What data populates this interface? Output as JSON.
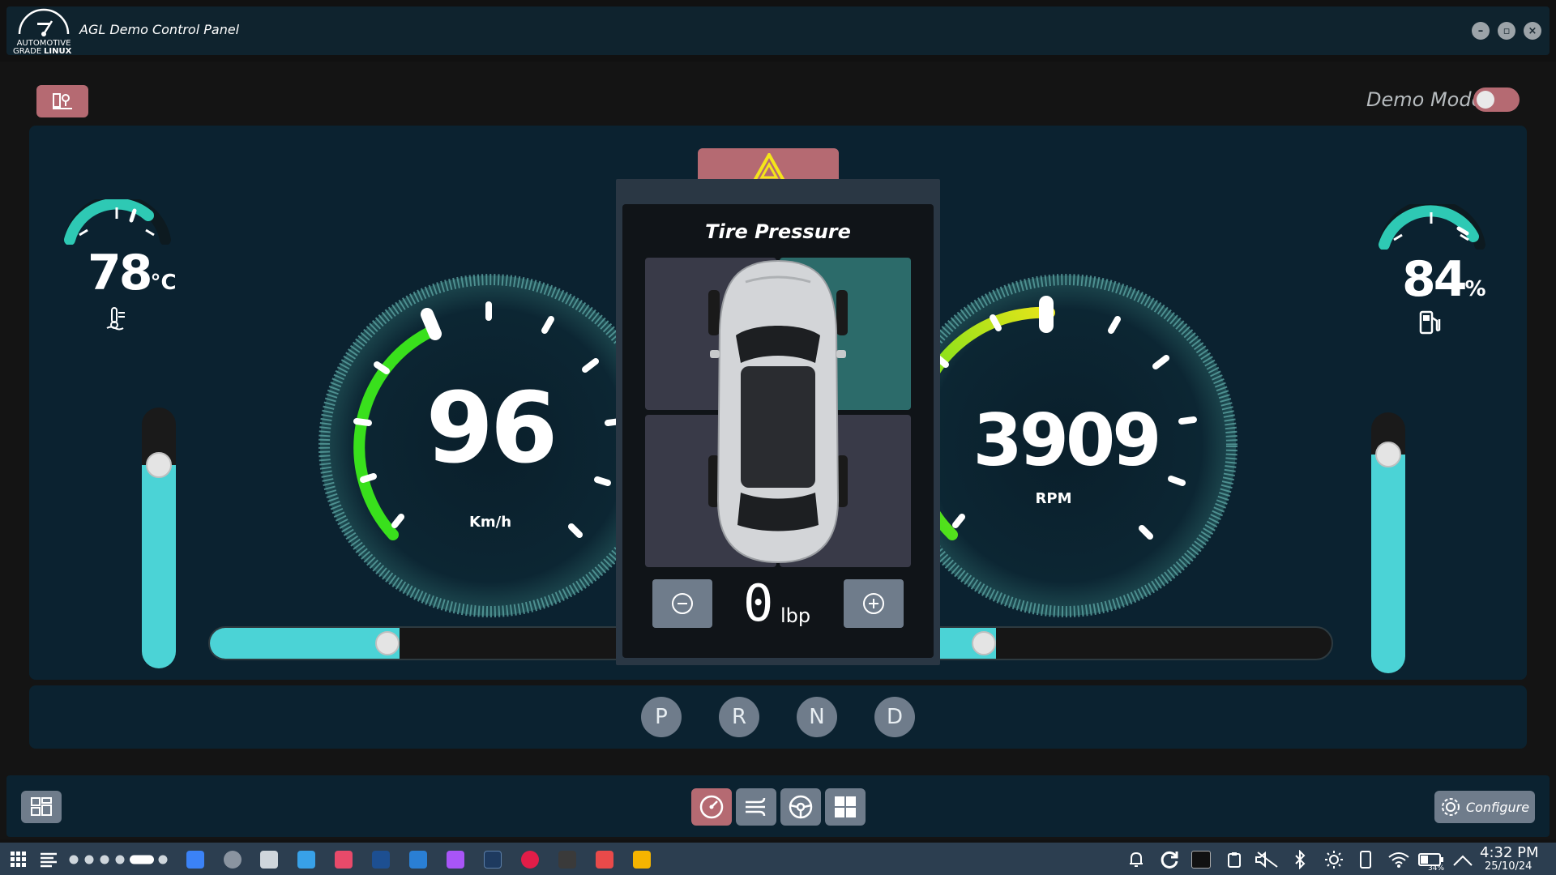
{
  "window": {
    "title": "AGL Demo Control Panel",
    "logo_text_line1": "AUTOMOTIVE",
    "logo_text_line2": "GRADE",
    "logo_text_line2b": "LINUX"
  },
  "header": {
    "demo_mode_label": "Demo Mode",
    "demo_mode_on": false
  },
  "temperature": {
    "value": "78",
    "unit": "°C",
    "slider_level": 0.78
  },
  "fuel": {
    "value": "84",
    "unit": "%",
    "slider_level": 0.84
  },
  "speed_gauge": {
    "value": "96",
    "unit": "Km/h",
    "slider_level": 0.38
  },
  "rpm_gauge": {
    "value": "3909",
    "unit": "RPM",
    "slider_level": 0.3
  },
  "tire_pressure": {
    "title": "Tire Pressure",
    "value": "0",
    "unit": "lbp",
    "selected_tire": "front-right"
  },
  "gears": [
    "P",
    "R",
    "N",
    "D"
  ],
  "bottom_bar": {
    "configure_label": "Configure",
    "apps": [
      "speedometer",
      "hvac",
      "steering",
      "dashboard"
    ]
  },
  "taskbar": {
    "time": "4:32 PM",
    "date": "25/10/24",
    "battery": "34%"
  },
  "colors": {
    "accent_teal": "#4bd3d6",
    "accent_rose": "#b56a72",
    "panel_bg": "#0b2230",
    "button_gray": "#6f7c8b",
    "gauge_green": "#39e01c"
  }
}
